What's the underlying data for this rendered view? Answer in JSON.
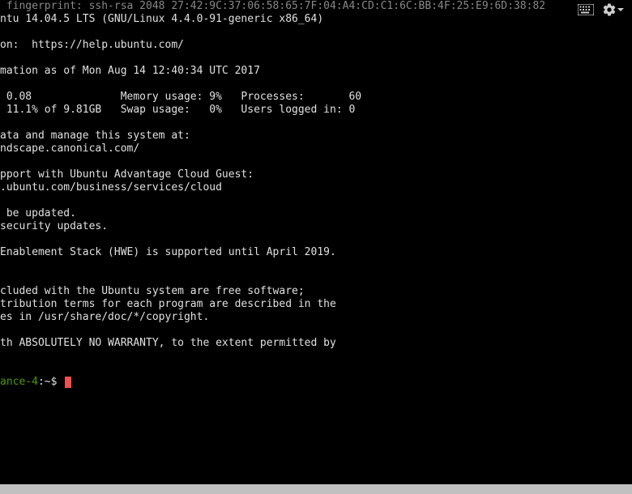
{
  "header": {
    "keyboard_icon": "keyboard",
    "gear_icon": "settings"
  },
  "terminal": {
    "fingerprint_line": " fingerprint: ssh-rsa 2048 27:42:9C:37:06:58:65:7F:04:A4:CD:C1:6C:BB:4F:25:E9:6D:38:82",
    "os_line": "ntu 14.04.5 LTS (GNU/Linux 4.4.0-91-generic x86_64)",
    "help_line": "on:  https://help.ubuntu.com/",
    "sysinfo_line": "mation as of Mon Aug 14 12:40:34 UTC 2017",
    "stats_line1": " 0.08              Memory usage: 9%   Processes:       60",
    "stats_line2": " 11.1% of 9.81GB   Swap usage:   0%   Users logged in: 0",
    "manage_line1": "ata and manage this system at:",
    "manage_line2": "ndscape.canonical.com/",
    "advantage_line1": "pport with Ubuntu Advantage Cloud Guest:",
    "advantage_line2": ".ubuntu.com/business/services/cloud",
    "updates_line1": " be updated.",
    "updates_line2": "security updates.",
    "hwe_line": "Enablement Stack (HWE) is supported until April 2019.",
    "legal_line1": "cluded with the Ubuntu system are free software;",
    "legal_line2": "tribution terms for each program are described in the",
    "legal_line3": "es in /usr/share/doc/*/copyright.",
    "warranty_line": "th ABSOLUTELY NO WARRANTY, to the extent permitted by",
    "prompt_user": "ance-4",
    "prompt_path": ":~",
    "prompt_symbol": "$"
  }
}
